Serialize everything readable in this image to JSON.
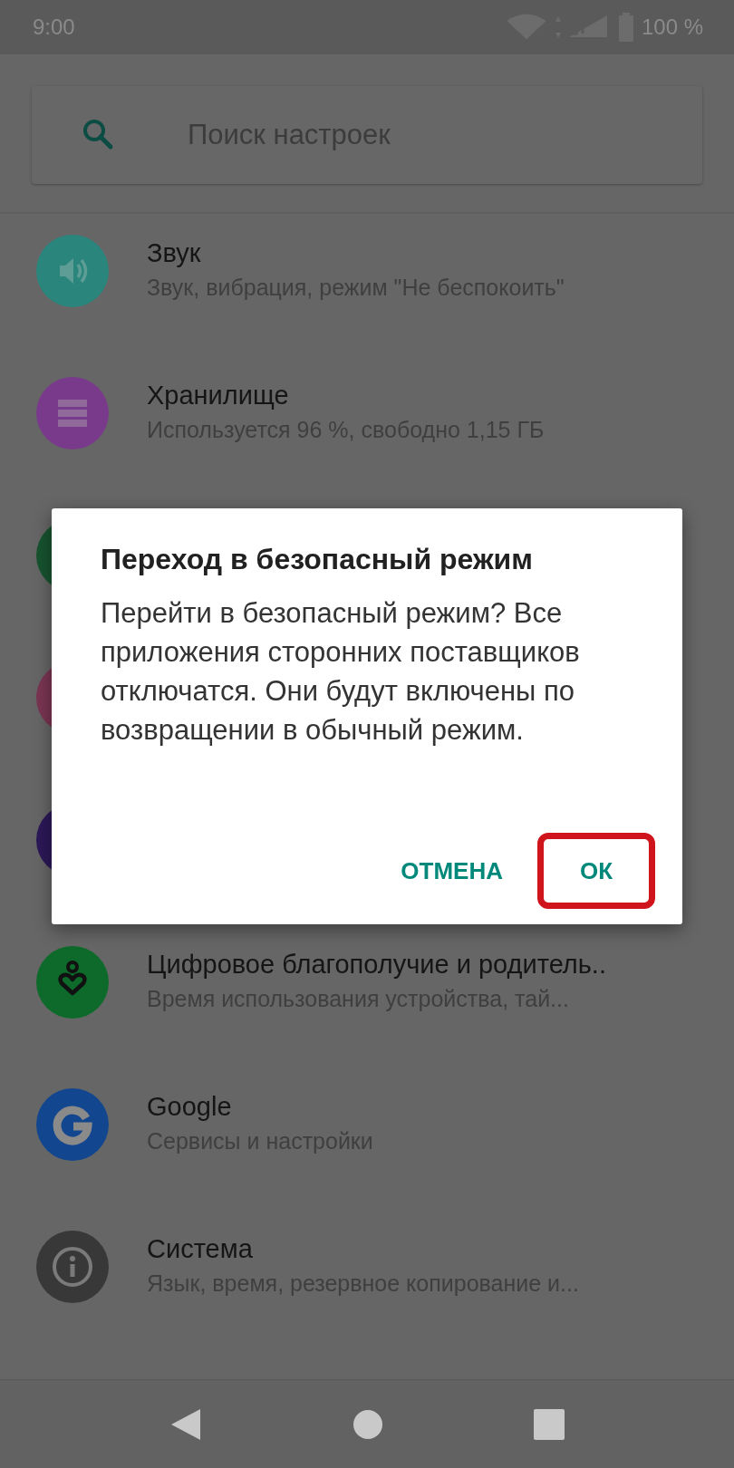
{
  "status_bar": {
    "time": "9:00",
    "battery": "100 %"
  },
  "search": {
    "placeholder": "Поиск настроек"
  },
  "settings": [
    {
      "title": "Звук",
      "subtitle": "Звук, вибрация, режим \"Не беспокоить\"",
      "color": "#2a867c",
      "kind": "sound"
    },
    {
      "title": "Хранилище",
      "subtitle": "Используется 96 %, свободно 1,15 ГБ",
      "color": "#7a3a8c",
      "kind": "storage"
    },
    {
      "color": "#17532f",
      "kind": "hidden"
    },
    {
      "color": "#7a3552",
      "kind": "hidden"
    },
    {
      "color": "#2c1858",
      "kind": "hidden"
    },
    {
      "title": "Цифровое благополучие и родитель..",
      "subtitle": "Время использования устройства, тай...",
      "color": "#0d6a2a",
      "kind": "wellbeing"
    },
    {
      "title": "Google",
      "subtitle": "Сервисы и настройки",
      "color": "#12478f",
      "kind": "google"
    },
    {
      "title": "Система",
      "subtitle": "Язык, время, резервное копирование и...",
      "color": "#383838",
      "kind": "system"
    }
  ],
  "dialog": {
    "title": "Переход в безопасный режим",
    "message": "Перейти в безопасный режим? Все приложения сторонних поставщиков отключатся. Они будут включены по возвращении в обычный режим.",
    "buttons": [
      {
        "label": "ОТМЕНА",
        "highlighted": false
      },
      {
        "label": "ОК",
        "highlighted": true
      }
    ]
  }
}
